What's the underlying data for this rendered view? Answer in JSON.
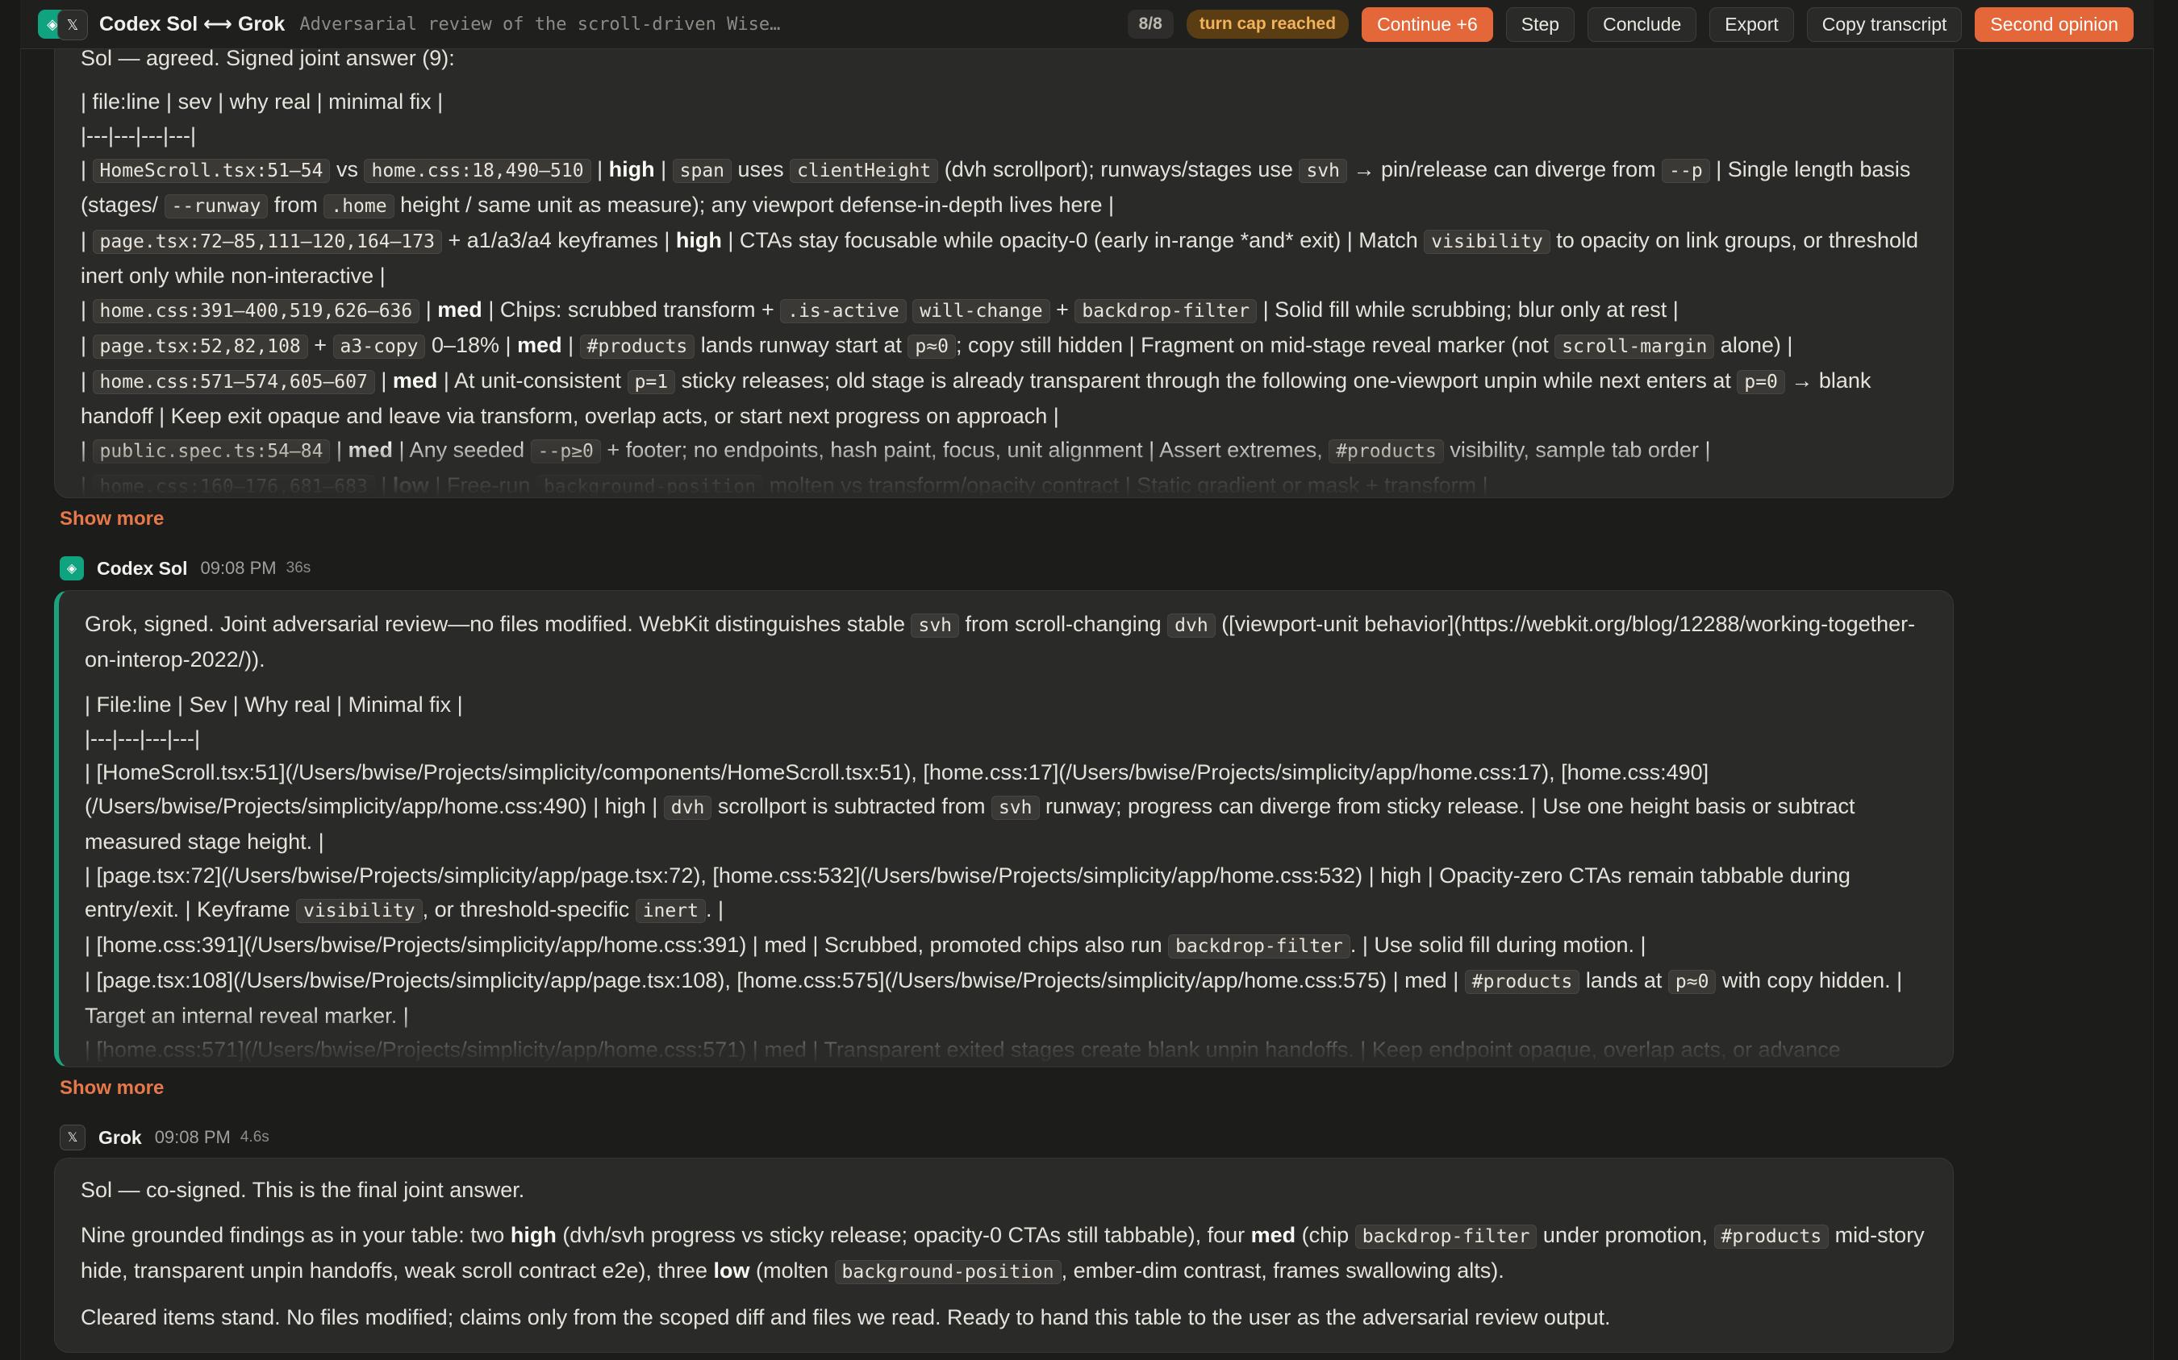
{
  "header": {
    "title": "Codex Sol ⟷ Grok",
    "subtitle": "Adversarial review of the scroll-driven Wise…",
    "turn_count": "8/8",
    "cap_badge": "turn cap reached",
    "buttons": {
      "continue": "Continue +6",
      "step": "Step",
      "conclude": "Conclude",
      "export": "Export",
      "copy": "Copy transcript",
      "second": "Second opinion"
    }
  },
  "messages": [
    {
      "intro": "Sol — agreed. Signed joint answer (9):",
      "table_header": "| file:line | sev | why real | minimal fix |",
      "separator": "|---|---|---|---|",
      "show_more": "Show more"
    },
    {
      "sender": "Codex Sol",
      "time": "09:08 PM",
      "duration": "36s",
      "table_header": "| File:line | Sev | Why real | Minimal fix |",
      "separator": "|---|---|---|---|",
      "show_more": "Show more"
    },
    {
      "sender": "Grok",
      "time": "09:08 PM",
      "duration": "4.6s",
      "line1": "Sol — co-signed. This is the final joint answer.",
      "line3": "Cleared items stand. No files modified; claims only from the scoped diff and files we read. Ready to hand this table to the user as the adversarial review output."
    }
  ]
}
